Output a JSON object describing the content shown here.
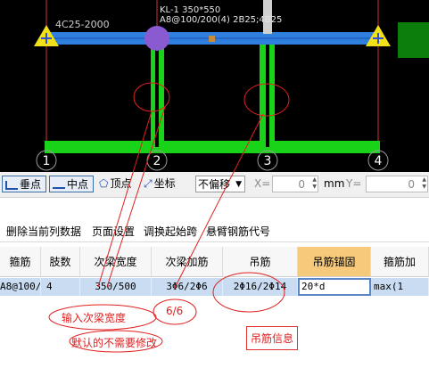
{
  "cad": {
    "label_left": "4C25-2000",
    "beam_title": "KL-1 350*550",
    "beam_spec": "A8@100/200(4) 2B25;4B25",
    "axis_numbers": [
      "1",
      "2",
      "3",
      "4"
    ],
    "colors": {
      "beam": "#2f7fdf",
      "wall": "#19d319",
      "axis": "#cc3333",
      "background": "#000000",
      "highlight": "#8a5ad0"
    }
  },
  "toolbar": {
    "perpendicular": "垂点",
    "midpoint": "中点",
    "vertex": "顶点",
    "coordinate": "坐标",
    "offset_select": "不偏移",
    "x_label": "X=",
    "x_value": "0",
    "unit": "mm",
    "y_label": "Y=",
    "y_value": "0"
  },
  "menu": {
    "items": [
      "删除当前列数据",
      "页面设置",
      "调换起始跨",
      "悬臂钢筋代号"
    ]
  },
  "grid": {
    "headers": [
      "箍筋",
      "肢数",
      "次梁宽度",
      "次梁加筋",
      "吊筋",
      "吊筋锚固",
      "箍筋加"
    ],
    "row": [
      "A8@100/20",
      "4",
      "350/500",
      "3Φ6/2Φ6",
      "2Φ16/2Φ14",
      "20*d",
      "max(1"
    ]
  },
  "annotations": {
    "note1": "输入次梁宽度",
    "note2": "6/6",
    "note3": "吊筋信息",
    "note4": "默认的不需要修改"
  }
}
